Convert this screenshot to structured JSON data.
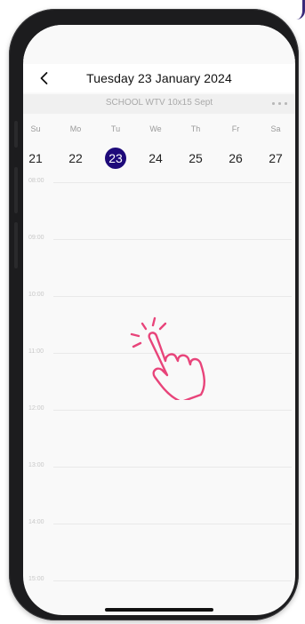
{
  "header": {
    "title": "Tuesday 23 January 2024"
  },
  "calendar": {
    "subtitle": "SCHOOL WTV 10x15 Sept",
    "weekdays": [
      "Su",
      "Mo",
      "Tu",
      "We",
      "Th",
      "Fr",
      "Sa"
    ],
    "dates": [
      "21",
      "22",
      "23",
      "24",
      "25",
      "26",
      "27"
    ],
    "selected_index": 2
  },
  "timeline": {
    "hours": [
      "08:00",
      "09:00",
      "10:00",
      "11:00",
      "12:00",
      "13:00",
      "14:00",
      "15:00"
    ]
  },
  "colors": {
    "selected": "#1e0a7a",
    "hand": "#e8447a",
    "phone": "#1c1c1e"
  },
  "icons": [
    "back-arrow-icon",
    "more-icon",
    "tap-hand-icon"
  ]
}
